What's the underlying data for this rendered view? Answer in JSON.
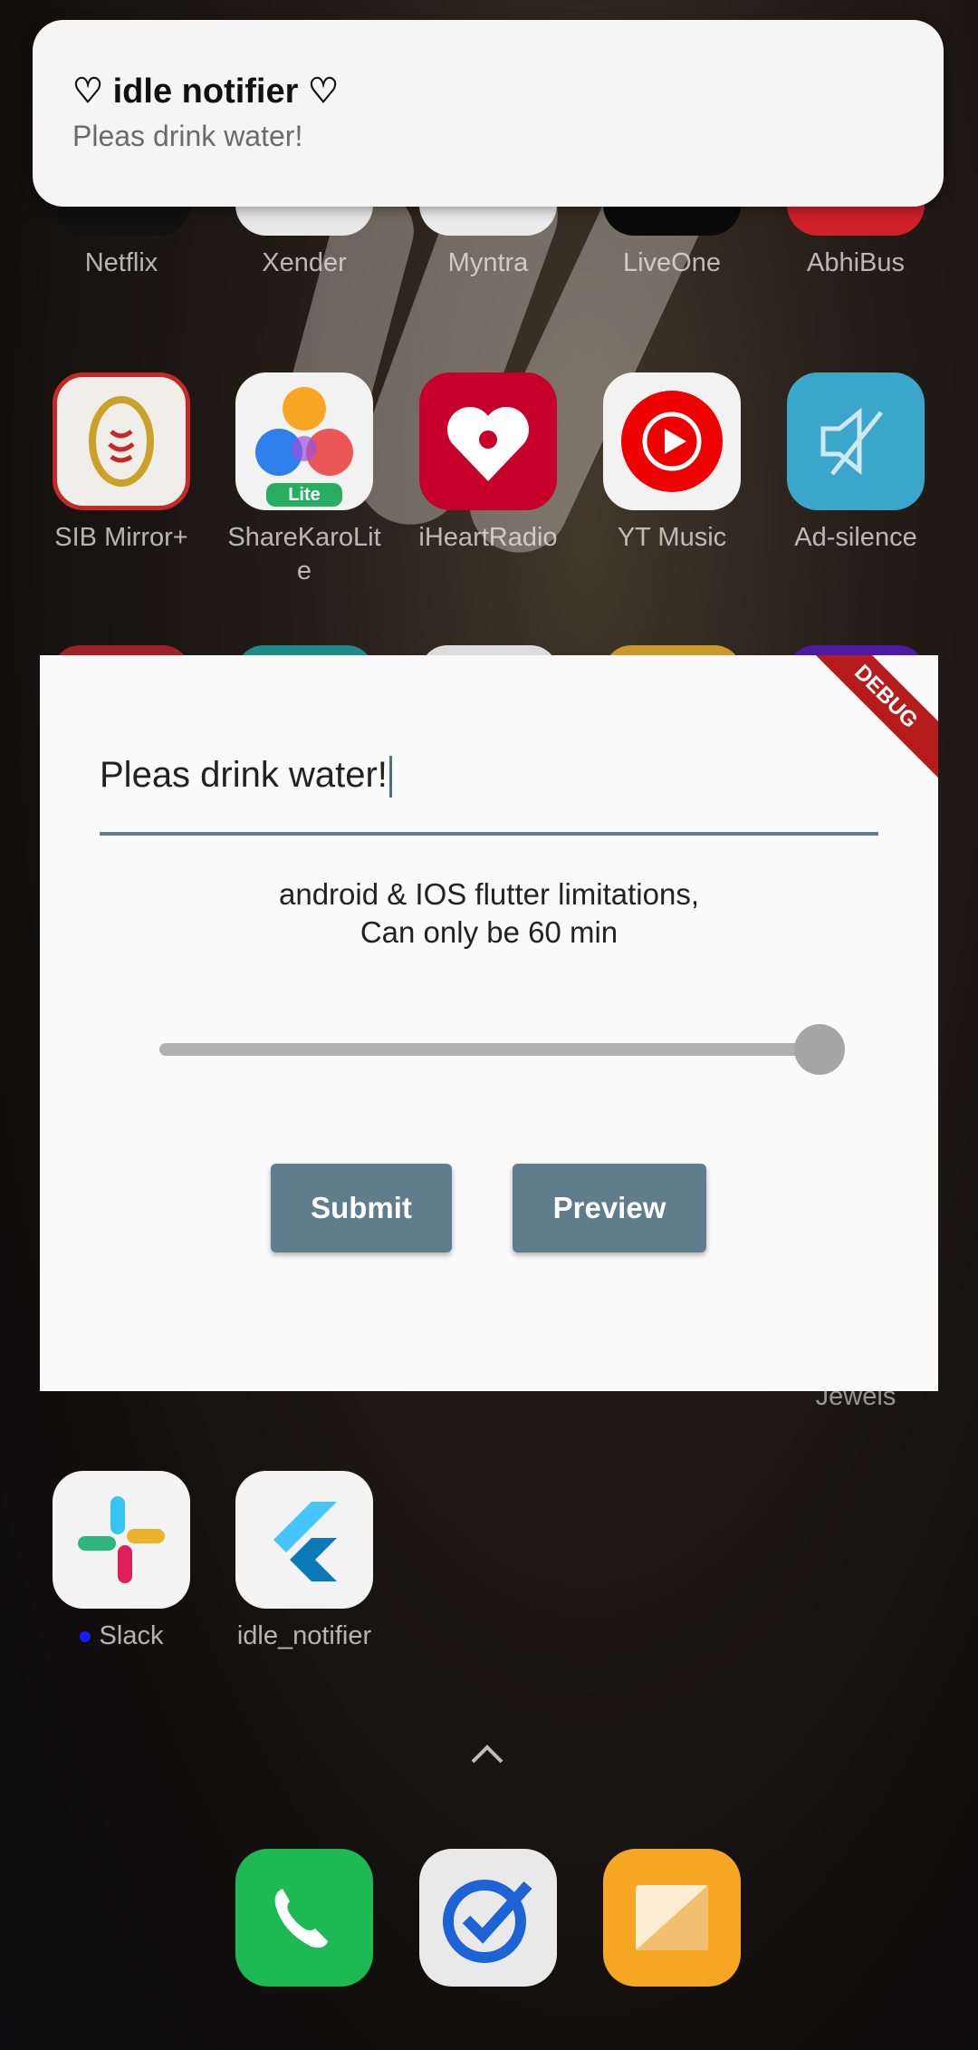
{
  "notification": {
    "title": "♡ idle notifier ♡",
    "body": "Pleas drink water!"
  },
  "home_row_1": [
    {
      "label": "Netflix"
    },
    {
      "label": "Xender"
    },
    {
      "label": "Myntra"
    },
    {
      "label": "LiveOne"
    },
    {
      "label": "AbhiBus"
    }
  ],
  "home_row_2": [
    {
      "label": "SIB Mirror+"
    },
    {
      "label": "ShareKaroLite"
    },
    {
      "label": "iHeartRadio"
    },
    {
      "label": "YT Music"
    },
    {
      "label": "Ad-silence"
    }
  ],
  "sharekaro_badge": "Lite",
  "home_row_4": [
    {
      "label": "Slack"
    },
    {
      "label": "idle_notifier"
    }
  ],
  "partial_label": "Jewels",
  "dialog": {
    "input_value": "Pleas drink water!",
    "note_line1": "android & IOS flutter limitations,",
    "note_line2": "Can only be 60 min",
    "slider_value_fraction": 1.0,
    "submit_label": "Submit",
    "preview_label": "Preview",
    "debug_banner": "DEBUG"
  },
  "colors": {
    "dialog_bg": "#fafafa",
    "button": "#5f7d8c",
    "underline": "#607d8b",
    "debug": "#b71c1c"
  }
}
